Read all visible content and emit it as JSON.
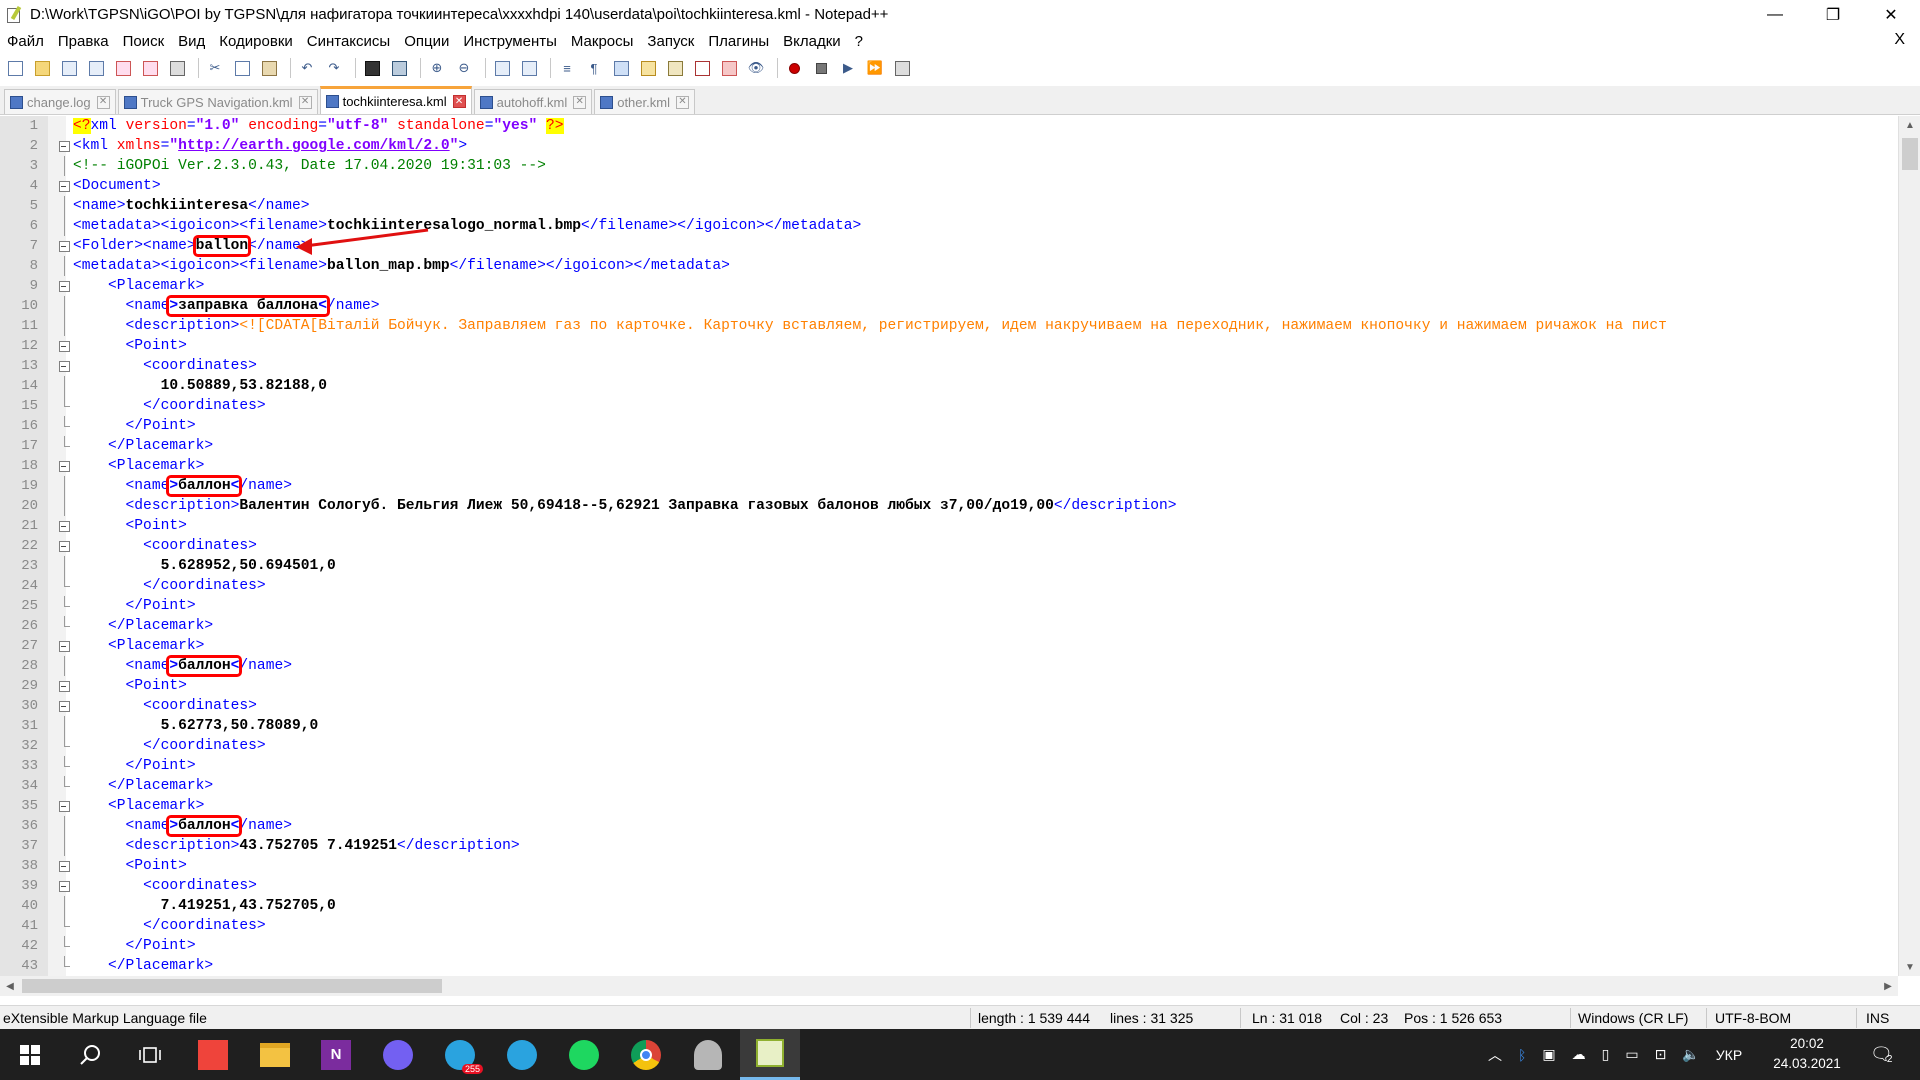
{
  "window": {
    "title": "D:\\Work\\TGPSN\\iGO\\POI by TGPSN\\для нафигатора точкиинтереса\\xxxxhdpi 140\\userdata\\poi\\tochkiinteresa.kml - Notepad++",
    "minimize": "—",
    "maximize": "❐",
    "close": "✕"
  },
  "menu": {
    "items": [
      "Файл",
      "Правка",
      "Поиск",
      "Вид",
      "Кодировки",
      "Синтаксисы",
      "Опции",
      "Инструменты",
      "Макросы",
      "Запуск",
      "Плагины",
      "Вкладки",
      "?"
    ],
    "close_doc": "X"
  },
  "tabs": [
    {
      "label": "change.log",
      "active": false
    },
    {
      "label": "Truck GPS Navigation.kml",
      "active": false
    },
    {
      "label": "tochkiinteresa.kml",
      "active": true
    },
    {
      "label": "autohoff.kml",
      "active": false
    },
    {
      "label": "other.kml",
      "active": false
    }
  ],
  "editor": {
    "lines": [
      {
        "n": "1"
      },
      {
        "n": "2"
      },
      {
        "n": "3"
      },
      {
        "n": "4"
      },
      {
        "n": "5"
      },
      {
        "n": "6"
      },
      {
        "n": "7"
      },
      {
        "n": "8"
      },
      {
        "n": "9"
      },
      {
        "n": "10"
      },
      {
        "n": "11"
      },
      {
        "n": "12"
      },
      {
        "n": "13"
      },
      {
        "n": "14"
      },
      {
        "n": "15"
      },
      {
        "n": "16"
      },
      {
        "n": "17"
      },
      {
        "n": "18"
      },
      {
        "n": "19"
      },
      {
        "n": "20"
      },
      {
        "n": "21"
      },
      {
        "n": "22"
      },
      {
        "n": "23"
      },
      {
        "n": "24"
      },
      {
        "n": "25"
      },
      {
        "n": "26"
      },
      {
        "n": "27"
      },
      {
        "n": "28"
      },
      {
        "n": "29"
      },
      {
        "n": "30"
      },
      {
        "n": "31"
      },
      {
        "n": "32"
      },
      {
        "n": "33"
      },
      {
        "n": "34"
      },
      {
        "n": "35"
      },
      {
        "n": "36"
      },
      {
        "n": "37"
      },
      {
        "n": "38"
      },
      {
        "n": "39"
      },
      {
        "n": "40"
      },
      {
        "n": "41"
      },
      {
        "n": "42"
      },
      {
        "n": "43"
      }
    ],
    "xml_decl": {
      "open": "<?",
      "name": "xml",
      "version_attr": "version",
      "version": "\"1.0\"",
      "encoding_attr": "encoding",
      "encoding": "\"utf-8\"",
      "standalone_attr": "standalone",
      "standalone": "\"yes\"",
      "close": "?>"
    },
    "kml_open": {
      "tag": "<kml",
      "attr": "xmlns",
      "eq": "=",
      "q1": "\"",
      "url": "http://earth.google.com/kml/2.0",
      "q2": "\"",
      "end": ">"
    },
    "comment": "<!-- iGOPOi Ver.2.3.0.43, Date 17.04.2020 19:31:03 -->",
    "doc_open": "<Document>",
    "doc_name": {
      "open": "<name>",
      "value": "tochkiinteresa",
      "close": "</name>"
    },
    "doc_meta": {
      "open": "<metadata><igoicon><filename>",
      "value": "tochkiinteresalogo_normal.bmp",
      "close": "</filename></igoicon></metadata>"
    },
    "folder": {
      "open": "<Folder><name>",
      "value": "ballon",
      "close": "</name>"
    },
    "folder_meta": {
      "open": "<metadata><igoicon><filename>",
      "value": "ballon_map.bmp",
      "close": "</filename></igoicon></metadata>"
    },
    "tags": {
      "placemark_open": "<Placemark>",
      "placemark_close": "</Placemark>",
      "name_open": "<name>",
      "name_close": "</name>",
      "name_open_trunc": "<name",
      "name_close_trunc": "/name>",
      "point_open": "<Point>",
      "point_close": "</Point>",
      "coords_open": "<coordinates>",
      "coords_close": "</coordinates>",
      "desc_open": "<description>",
      "desc_close": "</description>",
      "lt": "<",
      "gt": ">"
    },
    "placemarks": [
      {
        "name": "заправка баллона",
        "description": "<![CDATA[Віталій Бойчук. Заправляем газ по карточке. Карточку вставляем, регистрируем, идем накручиваем на переходник, нажимаем кнопочку и нажимаем ричажок на пист",
        "coordinates": "10.50889,53.82188,0"
      },
      {
        "name": "баллон",
        "description": "Валентин Сологуб. Бельгия Лиеж 50,69418--5,62921 Заправка газовых балонов любых з7,00/до19,00",
        "coordinates": "5.628952,50.694501,0"
      },
      {
        "name": "баллон",
        "coordinates": "5.62773,50.78089,0"
      },
      {
        "name": "баллон",
        "description": "43.752705 7.419251",
        "coordinates": "7.419251,43.752705,0"
      }
    ]
  },
  "status": {
    "file_type": "eXtensible Markup Language file",
    "length": "length : 1 539 444",
    "lines": "lines : 31 325",
    "ln": "Ln : 31 018",
    "col": "Col : 23",
    "pos": "Pos : 1 526 653",
    "eol": "Windows (CR LF)",
    "encoding": "UTF-8-BOM",
    "mode": "INS"
  },
  "taskbar": {
    "telegram_badge": "255",
    "language": "УКР",
    "time": "20:02",
    "date": "24.03.2021",
    "notifications": "2"
  }
}
